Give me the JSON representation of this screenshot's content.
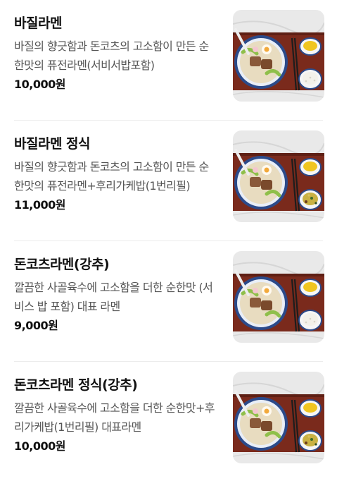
{
  "menu": {
    "items": [
      {
        "name": "바질라멘",
        "description": "바질의 향긋함과 돈코츠의 고소함이 만든 순한맛의 퓨전라멘(서비서밥포함)",
        "price": "10,000원",
        "side": "rice",
        "icon": "ramen-photo"
      },
      {
        "name": "바질라멘 정식",
        "description": "바질의 향긋함과 돈코츠의 고소함이 만든 순한맛의 퓨전라멘+후리가케밥(1번리필)",
        "price": "11,000원",
        "side": "furikake",
        "icon": "ramen-set-photo"
      },
      {
        "name": "돈코츠라멘(강추)",
        "description": "깔끔한 사골육수에 고소함을 더한 순한맛 (서비스 밥 포함) 대표 라멘",
        "price": "9,000원",
        "side": "rice",
        "icon": "ramen-photo"
      },
      {
        "name": "돈코츠라멘 정식(강추)",
        "description": "깔끔한 사골육수에 고소함을 더한 순한맛+후리가케밥(1번리필) 대표라멘",
        "price": "10,000원",
        "side": "furikake",
        "icon": "ramen-set-photo"
      }
    ]
  },
  "colors": {
    "marble": "#e9e9e9",
    "tray": "#7a2a1c",
    "bowl_rim": "#2b4a8a",
    "broth": "#e8dcc0",
    "pork": "#8a5a3a",
    "egg_yolk": "#f2a93b",
    "greens": "#8fbf4a",
    "pickle": "#f0c51f",
    "rice": "#f3f1ea",
    "furikake": "#c9b143"
  }
}
